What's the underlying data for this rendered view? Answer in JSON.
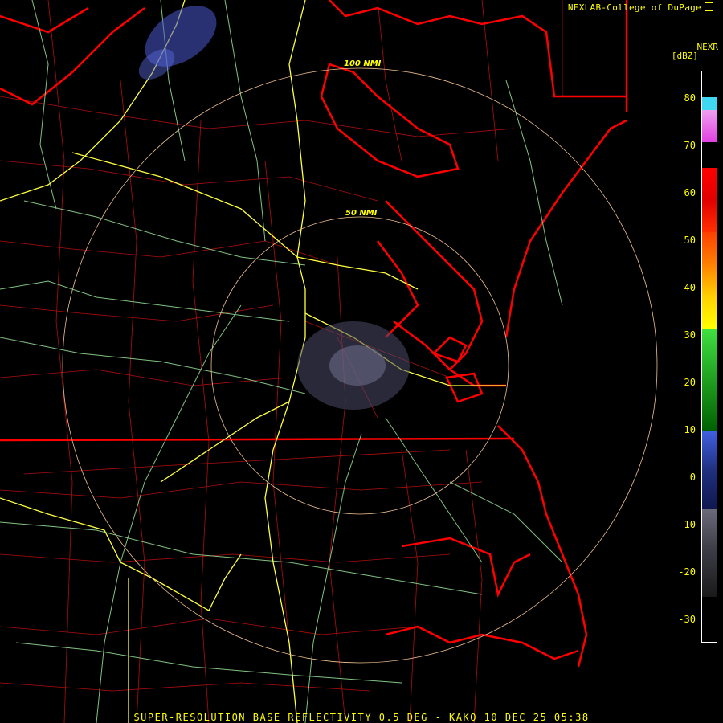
{
  "credit": "NEXLAB-College of DuPage",
  "legend": {
    "product": "NEXR",
    "unit": "[dBZ]",
    "ticks": [
      "80",
      "70",
      "60",
      "50",
      "40",
      "30",
      "20",
      "10",
      "0",
      "-10",
      "-20",
      "-30"
    ]
  },
  "range_rings": {
    "inner": "50 NMI",
    "outer": "100 NMI"
  },
  "footer": "SUPER-RESOLUTION BASE REFLECTIVITY 0.5 DEG - KAKQ 10 DEC 25 05:38",
  "colors": {
    "state_border": "#ff0000",
    "county": "#d01010",
    "highway": "#ffff40",
    "road": "#9ae09a",
    "ring": "#f0c090",
    "echo_low": "#5a5a7a",
    "echo_blue": "#5060e0"
  }
}
